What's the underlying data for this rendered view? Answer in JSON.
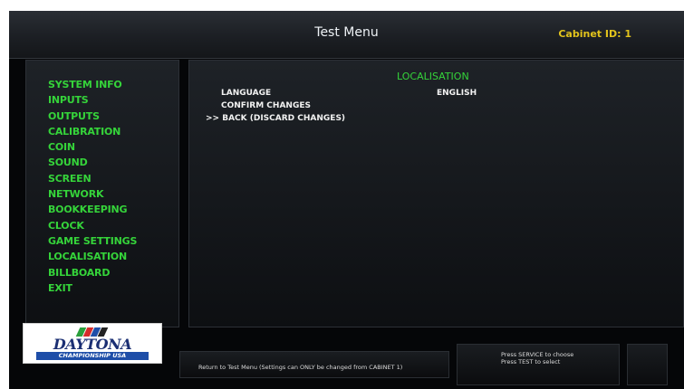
{
  "header": {
    "title": "Test Menu",
    "cabinet_id": "Cabinet ID: 1"
  },
  "sidebar": {
    "items": [
      {
        "label": "SYSTEM INFO"
      },
      {
        "label": "INPUTS"
      },
      {
        "label": "OUTPUTS"
      },
      {
        "label": "CALIBRATION"
      },
      {
        "label": "COIN"
      },
      {
        "label": "SOUND"
      },
      {
        "label": "SCREEN"
      },
      {
        "label": "NETWORK"
      },
      {
        "label": "BOOKKEEPING"
      },
      {
        "label": "CLOCK"
      },
      {
        "label": "GAME SETTINGS"
      },
      {
        "label": "LOCALISATION"
      },
      {
        "label": "BILLBOARD"
      },
      {
        "label": "EXIT"
      }
    ]
  },
  "main": {
    "section_title": "LOCALISATION",
    "rows": [
      {
        "label": "LANGUAGE",
        "value": "ENGLISH"
      },
      {
        "label": "CONFIRM CHANGES"
      },
      {
        "label": ">> BACK (DISCARD CHANGES)"
      }
    ]
  },
  "footer": {
    "logo": {
      "text": "DAYTONA",
      "subtitle": "CHAMPIONSHIP USA"
    },
    "help_text": "Return to Test Menu (Settings can ONLY be changed from CABINET 1)",
    "instructions": [
      "Press SERVICE to choose",
      "Press TEST to select"
    ]
  },
  "colors": {
    "menu_green": "#35d43a",
    "cabinet_yellow": "#e2c31c",
    "logo_blue": "#1b2f73"
  }
}
